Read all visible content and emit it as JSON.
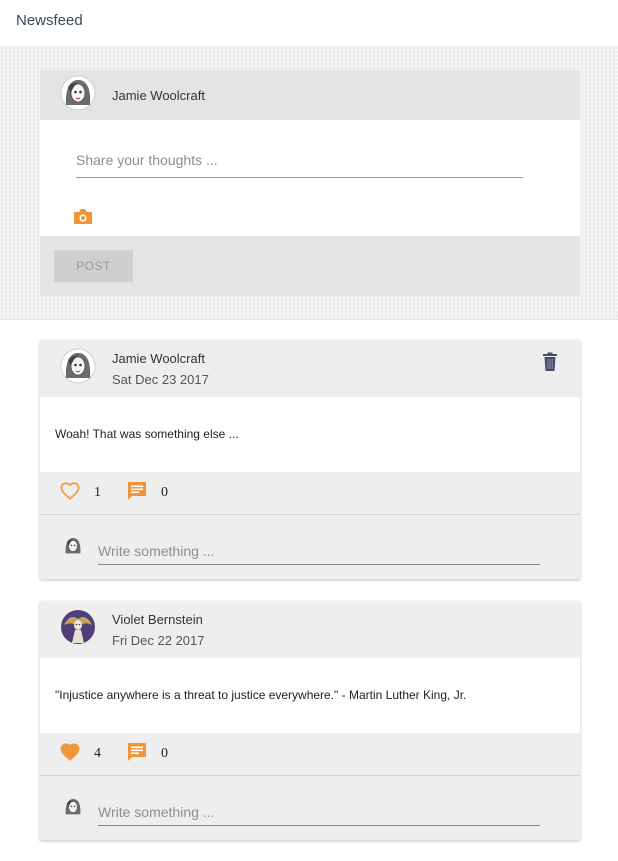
{
  "header": {
    "title": "Newsfeed"
  },
  "compose": {
    "user_name": "Jamie Woolcraft",
    "placeholder": "Share your thoughts ...",
    "post_label": "POST"
  },
  "posts": [
    {
      "author": "Jamie Woolcraft",
      "date": "Sat Dec 23 2017",
      "text": "Woah! That was something else ...",
      "likes": "1",
      "comments": "0",
      "liked": false,
      "comment_placeholder": "Write something ..."
    },
    {
      "author": "Violet Bernstein",
      "date": "Fri Dec 22 2017",
      "text": "\"Injustice anywhere is a threat to justice everywhere.\" - Martin Luther King, Jr.",
      "likes": "4",
      "comments": "0",
      "liked": true,
      "comment_placeholder": "Write something ..."
    }
  ],
  "colors": {
    "accent": "#f0963a",
    "panel": "#e2e5e4"
  },
  "icons": {
    "camera": "camera-icon",
    "trash": "trash-icon",
    "heart": "heart-icon",
    "comment": "comment-icon"
  }
}
